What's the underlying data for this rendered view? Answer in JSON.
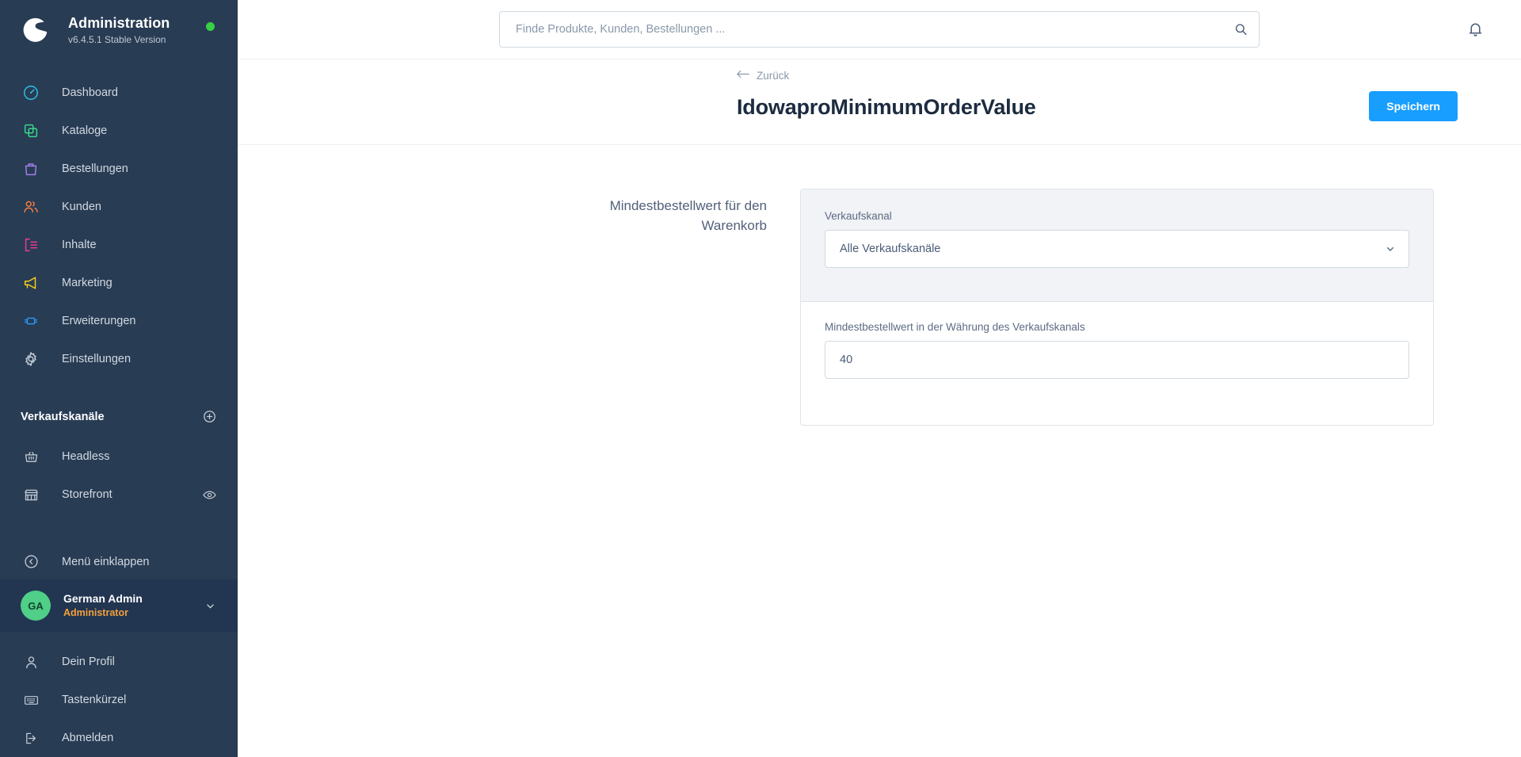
{
  "brand": {
    "title": "Administration",
    "version": "v6.4.5.1 Stable Version",
    "logo_icon": "shopware-logo-icon",
    "status_dot_color": "#37d046"
  },
  "sidebar": {
    "main_items": [
      {
        "label": "Dashboard",
        "icon": "dashboard-icon",
        "color": "#2fc0e3"
      },
      {
        "label": "Kataloge",
        "icon": "catalog-icon",
        "color": "#37d88a"
      },
      {
        "label": "Bestellungen",
        "icon": "bag-icon",
        "color": "#a37fe8"
      },
      {
        "label": "Kunden",
        "icon": "users-icon",
        "color": "#f47e3d"
      },
      {
        "label": "Inhalte",
        "icon": "content-icon",
        "color": "#ee3b8f"
      },
      {
        "label": "Marketing",
        "icon": "megaphone-icon",
        "color": "#f5cd19"
      },
      {
        "label": "Erweiterungen",
        "icon": "plugin-icon",
        "color": "#2b93f0"
      },
      {
        "label": "Einstellungen",
        "icon": "gear-icon",
        "color": "#c3cbd6"
      }
    ],
    "sales_channels_title": "Verkaufskanäle",
    "sales_channels_add_icon": "plus-circle-icon",
    "channels": [
      {
        "label": "Headless",
        "icon": "basket-icon",
        "has_eye": false
      },
      {
        "label": "Storefront",
        "icon": "shop-icon",
        "has_eye": true,
        "eye_icon": "eye-icon"
      }
    ],
    "collapse": {
      "label": "Menü einklappen",
      "icon": "chevron-left-circle-icon"
    },
    "user": {
      "initials": "GA",
      "name": "German Admin",
      "role": "Administrator",
      "caret_icon": "chevron-down-icon",
      "avatar_color": "#4fcf87",
      "role_color": "#f2a13c"
    },
    "user_items": [
      {
        "label": "Dein Profil",
        "icon": "person-icon"
      },
      {
        "label": "Tastenkürzel",
        "icon": "keyboard-icon"
      },
      {
        "label": "Abmelden",
        "icon": "logout-icon"
      }
    ]
  },
  "topbar": {
    "search_placeholder": "Finde Produkte, Kunden, Bestellungen ...",
    "search_value": "",
    "search_icon": "search-icon",
    "notifications_icon": "bell-icon"
  },
  "page": {
    "back_label": "Zurück",
    "back_icon": "arrow-left-icon",
    "title": "IdowaproMinimumOrderValue",
    "save_label": "Speichern",
    "save_color": "#189eff"
  },
  "form": {
    "group_label": "Mindestbestellwert für den Warenkorb",
    "sales_channel": {
      "label": "Verkaufskanal",
      "value": "Alle Verkaufskanäle",
      "caret_icon": "chevron-down-icon"
    },
    "minimum_value": {
      "label": "Mindestbestellwert in der Währung des Verkaufskanals",
      "value": "40",
      "placeholder": ""
    }
  }
}
